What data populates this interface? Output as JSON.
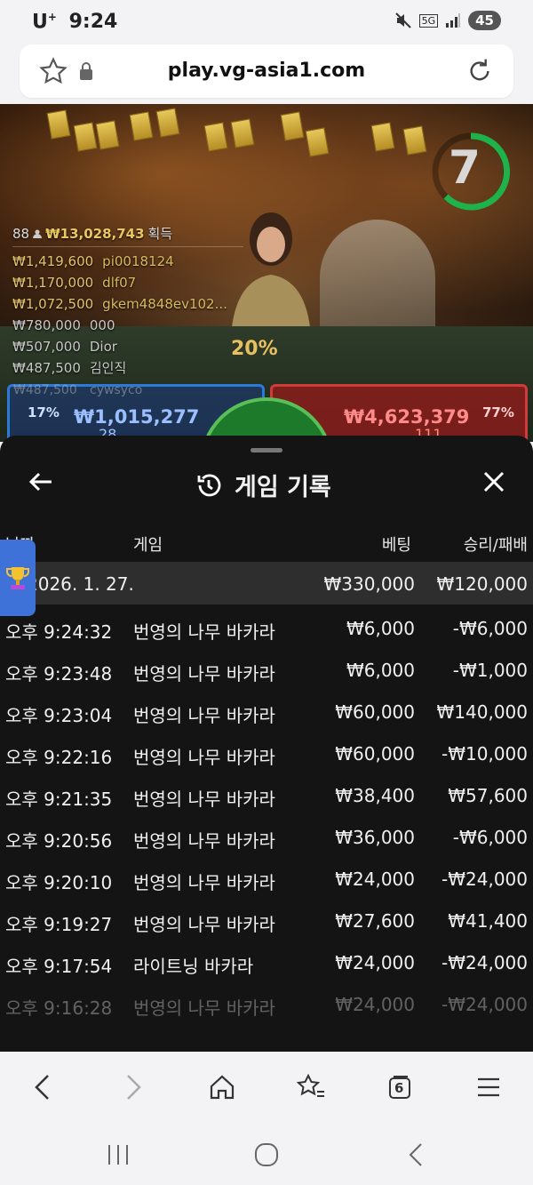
{
  "status": {
    "carrier": "U",
    "carrier_sup": "+",
    "time": "9:24",
    "network": "5G",
    "battery": "45"
  },
  "browser": {
    "url": "play.vg-asia1.com"
  },
  "game": {
    "timer": "7",
    "center_percent": "20%",
    "winners_header": {
      "count": "88",
      "amount": "₩13,028,743",
      "label": "획득"
    },
    "winners": [
      {
        "amount": "₩1,419,600",
        "name": "pi0018124"
      },
      {
        "amount": "₩1,170,000",
        "name": "dlf07"
      },
      {
        "amount": "₩1,072,500",
        "name": "gkem4848ev102..."
      },
      {
        "amount": "₩780,000",
        "name": "000"
      },
      {
        "amount": "₩507,000",
        "name": "Dior"
      },
      {
        "amount": "₩487,500",
        "name": "김인직"
      },
      {
        "amount": "₩487,500",
        "name": "cywsyco"
      }
    ],
    "player_bet": {
      "percent": "17%",
      "amount": "₩1,015,277",
      "count": "28"
    },
    "banker_bet": {
      "percent": "77%",
      "amount": "₩4,623,379",
      "count": "111"
    }
  },
  "history": {
    "title": "게임 기록",
    "columns": {
      "date": "날짜",
      "game": "게임",
      "bet": "베팅",
      "result": "승리/패배"
    },
    "date_row": {
      "date": "2026. 1. 27.",
      "bet": "₩330,000",
      "result": "₩120,000"
    },
    "rows": [
      {
        "time": "오후 9:24:32",
        "game": "번영의 나무 바카라",
        "bet": "₩6,000",
        "result": "-₩6,000"
      },
      {
        "time": "오후 9:23:48",
        "game": "번영의 나무 바카라",
        "bet": "₩6,000",
        "result": "-₩1,000"
      },
      {
        "time": "오후 9:23:04",
        "game": "번영의 나무 바카라",
        "bet": "₩60,000",
        "result": "₩140,000"
      },
      {
        "time": "오후 9:22:16",
        "game": "번영의 나무 바카라",
        "bet": "₩60,000",
        "result": "-₩10,000"
      },
      {
        "time": "오후 9:21:35",
        "game": "번영의 나무 바카라",
        "bet": "₩38,400",
        "result": "₩57,600"
      },
      {
        "time": "오후 9:20:56",
        "game": "번영의 나무 바카라",
        "bet": "₩36,000",
        "result": "-₩6,000"
      },
      {
        "time": "오후 9:20:10",
        "game": "번영의 나무 바카라",
        "bet": "₩24,000",
        "result": "-₩24,000"
      },
      {
        "time": "오후 9:19:27",
        "game": "번영의 나무 바카라",
        "bet": "₩27,600",
        "result": "₩41,400"
      },
      {
        "time": "오후 9:17:54",
        "game": "라이트닝 바카라",
        "bet": "₩24,000",
        "result": "-₩24,000"
      },
      {
        "time": "오후 9:16:28",
        "game": "번영의 나무 바카라",
        "bet": "₩24,000",
        "result": "-₩24,000"
      }
    ]
  },
  "nav": {
    "tabs_count": "6"
  },
  "colors": {
    "accent_gold": "#e3c36a",
    "player_blue": "#2d79d8",
    "banker_red": "#d23b3b",
    "sheet_bg": "#141414"
  }
}
